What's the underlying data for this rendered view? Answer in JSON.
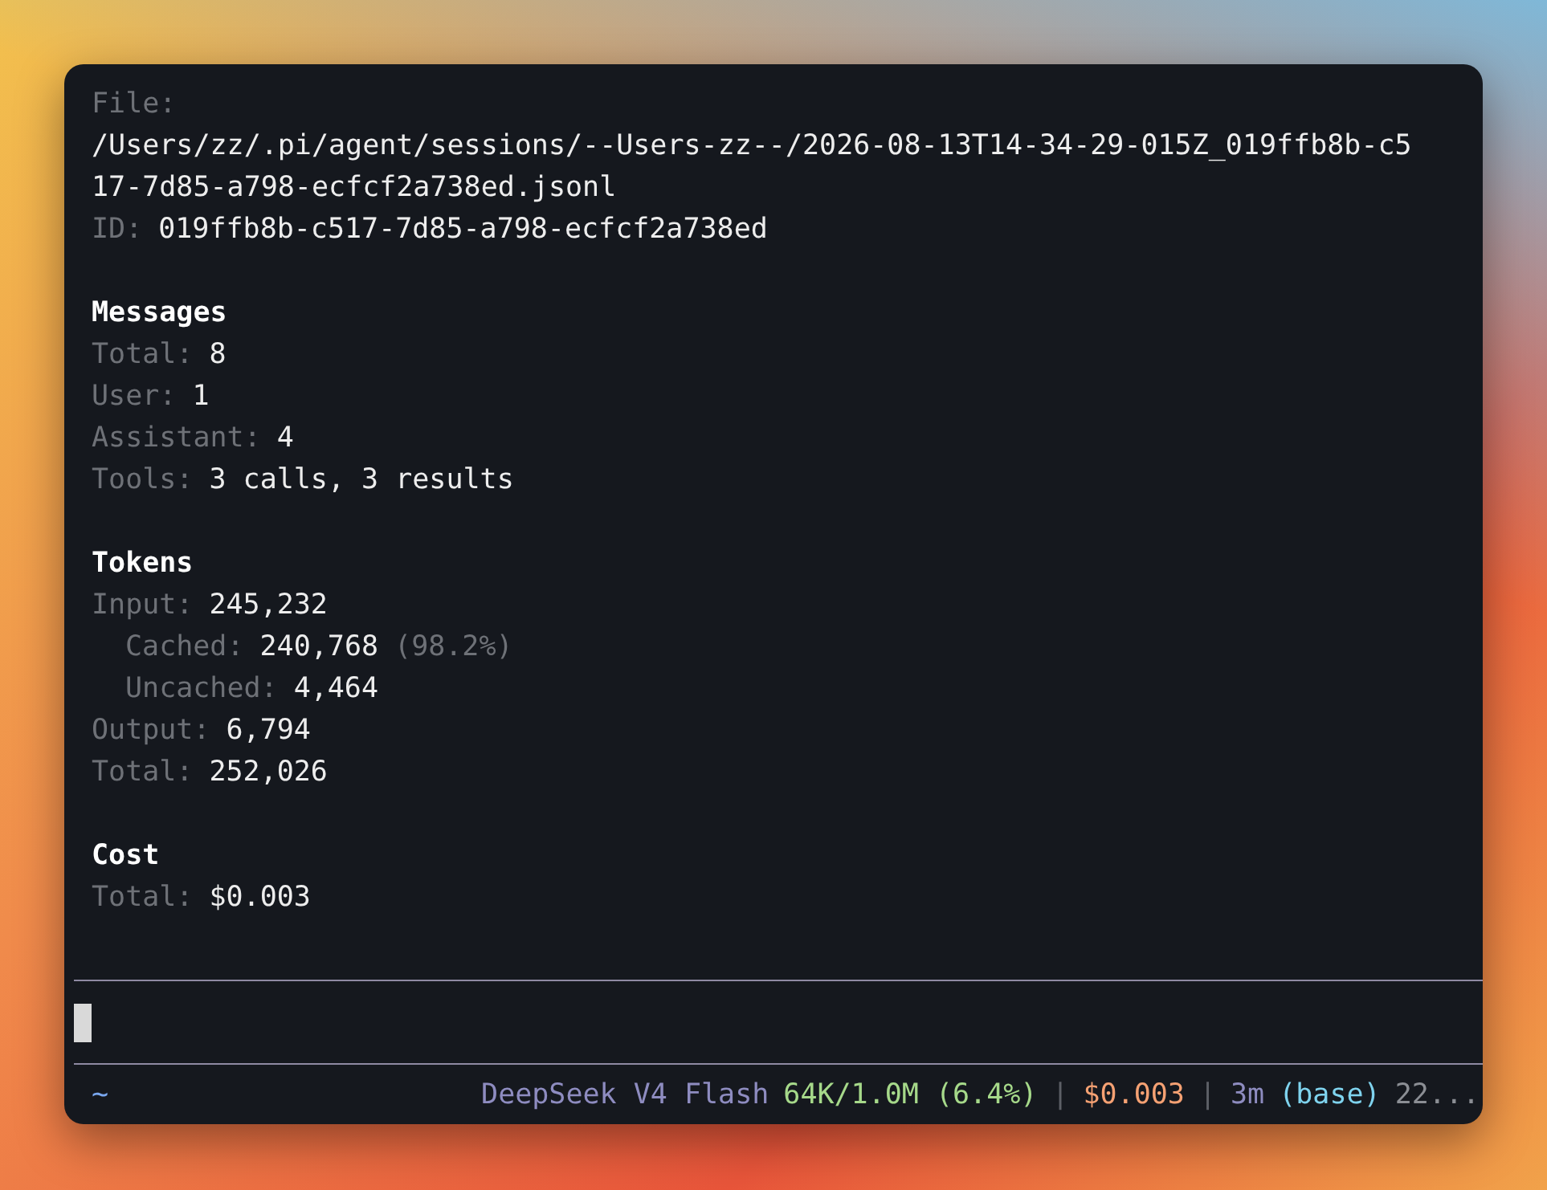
{
  "file": {
    "label": "File:",
    "path_lines": [
      "/Users/zz/.pi/agent/sessions/--Users-zz--/2026-08-13T14-34-29-015Z_019ffb8b-c5",
      "17-7d85-a798-ecfcf2a738ed.jsonl"
    ]
  },
  "id": {
    "label": "ID:",
    "value": "019ffb8b-c517-7d85-a798-ecfcf2a738ed"
  },
  "sections": [
    {
      "heading": "Messages",
      "rows": [
        {
          "label": "Total:",
          "value": "8"
        },
        {
          "label": "User:",
          "value": "1"
        },
        {
          "label": "Assistant:",
          "value": "4"
        },
        {
          "label": "Tools:",
          "value": "3 calls, 3 results"
        }
      ]
    },
    {
      "heading": "Tokens",
      "rows": [
        {
          "label": "Input:",
          "value": "245,232",
          "children": [
            {
              "label": "Cached:",
              "value": "240,768",
              "note": "(98.2%)"
            },
            {
              "label": "Uncached:",
              "value": "4,464"
            }
          ]
        },
        {
          "label": "Output:",
          "value": "6,794"
        },
        {
          "label": "Total:",
          "value": "252,026"
        }
      ]
    },
    {
      "heading": "Cost",
      "rows": [
        {
          "label": "Total:",
          "value": "$0.003"
        }
      ]
    }
  ],
  "status_bar": {
    "cwd": "~",
    "segments": [
      {
        "text": "DeepSeek V4 Flash",
        "color": "#8e8cc0"
      },
      {
        "text": "64K/1.0M (6.4%)",
        "color": "#a6d98a"
      },
      {
        "text": "|",
        "color": "#5c5f66"
      },
      {
        "text": "$0.003",
        "color": "#f5a173"
      },
      {
        "text": "|",
        "color": "#5c5f66"
      },
      {
        "text": "3m",
        "color": "#8e8cc0"
      },
      {
        "text": "(base)",
        "color": "#7fd3ee"
      },
      {
        "text": "22...",
        "color": "#8b8e94"
      }
    ]
  }
}
